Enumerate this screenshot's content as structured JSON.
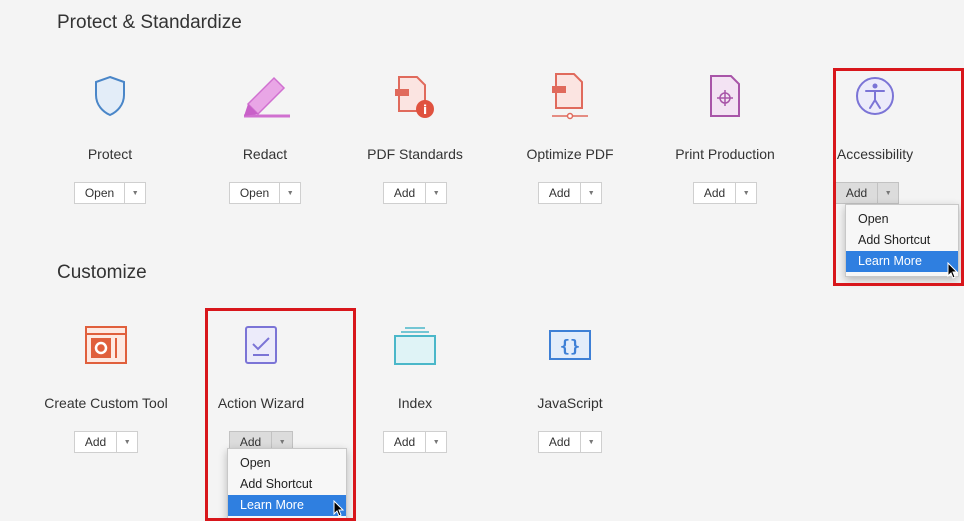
{
  "sections": {
    "protect": {
      "title": "Protect & Standardize"
    },
    "customize": {
      "title": "Customize"
    }
  },
  "tools": [
    {
      "name": "Protect",
      "action": "Open",
      "icon": "shield-icon"
    },
    {
      "name": "Redact",
      "action": "Open",
      "icon": "redact-marker-icon"
    },
    {
      "name": "PDF Standards",
      "action": "Add",
      "icon": "pdf-standards-icon"
    },
    {
      "name": "Optimize PDF",
      "action": "Add",
      "icon": "optimize-pdf-icon"
    },
    {
      "name": "Print Production",
      "action": "Add",
      "icon": "print-production-icon"
    },
    {
      "name": "Accessibility",
      "action": "Add",
      "icon": "accessibility-icon"
    },
    {
      "name": "Create Custom Tool",
      "action": "Add",
      "icon": "custom-tool-icon"
    },
    {
      "name": "Action Wizard",
      "action": "Add",
      "icon": "action-wizard-icon"
    },
    {
      "name": "Index",
      "action": "Add",
      "icon": "index-icon"
    },
    {
      "name": "JavaScript",
      "action": "Add",
      "icon": "javascript-icon"
    }
  ],
  "menus": {
    "accessibility": {
      "items": [
        "Open",
        "Add Shortcut",
        "Learn More"
      ],
      "highlighted": "Learn More"
    },
    "action_wizard": {
      "items": [
        "Open",
        "Add Shortcut",
        "Learn More"
      ],
      "highlighted": "Learn More"
    }
  },
  "colors": {
    "background": "#f4f4f4",
    "highlight_border": "#d8161b",
    "menu_selection": "#2f7fe0"
  }
}
